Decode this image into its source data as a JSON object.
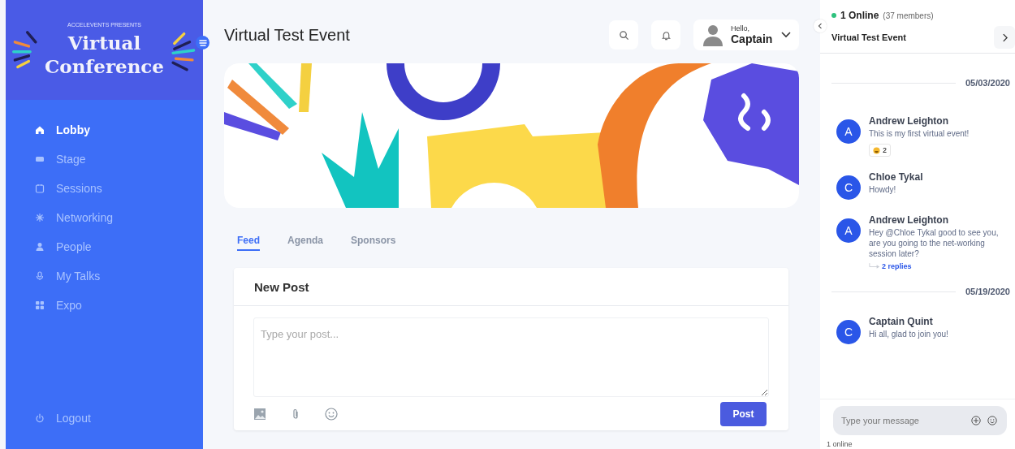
{
  "brand": {
    "presenter": "ACCELEVENTS PRESENTS",
    "title_line_1": "Virtual",
    "title_line_2": "Conference"
  },
  "sidebar": {
    "items": [
      {
        "label": "Lobby",
        "selected": true
      },
      {
        "label": "Stage",
        "selected": false
      },
      {
        "label": "Sessions",
        "selected": false
      },
      {
        "label": "Networking",
        "selected": false
      },
      {
        "label": "People",
        "selected": false
      },
      {
        "label": "My Talks",
        "selected": false
      },
      {
        "label": "Expo",
        "selected": false
      }
    ],
    "logout": "Logout"
  },
  "header": {
    "title": "Virtual Test Event",
    "greeting": "Hello,",
    "user_name": "Captain"
  },
  "tabs": [
    {
      "label": "Feed",
      "selected": true
    },
    {
      "label": "Agenda",
      "selected": false
    },
    {
      "label": "Sponsors",
      "selected": false
    }
  ],
  "new_post": {
    "title": "New Post",
    "placeholder": "Type your post...",
    "button": "Post"
  },
  "chat": {
    "online": "1 Online",
    "members": "(37 members)",
    "event": "Virtual Test Event",
    "entries": [
      {
        "kind": "date",
        "text": "05/03/2020"
      },
      {
        "kind": "message",
        "initial": "A",
        "name": "Andrew Leighton",
        "text": "This is my first virtual event!",
        "reaction_count": "2"
      },
      {
        "kind": "message",
        "initial": "C",
        "name": "Chloe Tykal",
        "text": "Howdy!"
      },
      {
        "kind": "message",
        "initial": "A",
        "name": "Andrew Leighton",
        "text": "Hey @Chloe Tykal good to see you, are you going to the net-working session later?",
        "replies": "2 replies"
      },
      {
        "kind": "date",
        "text": "05/19/2020"
      },
      {
        "kind": "message",
        "initial": "C",
        "name": "Captain Quint",
        "text": "Hi all, glad to join you!"
      }
    ],
    "input_placeholder": "Type your message",
    "footer": "1 online"
  }
}
